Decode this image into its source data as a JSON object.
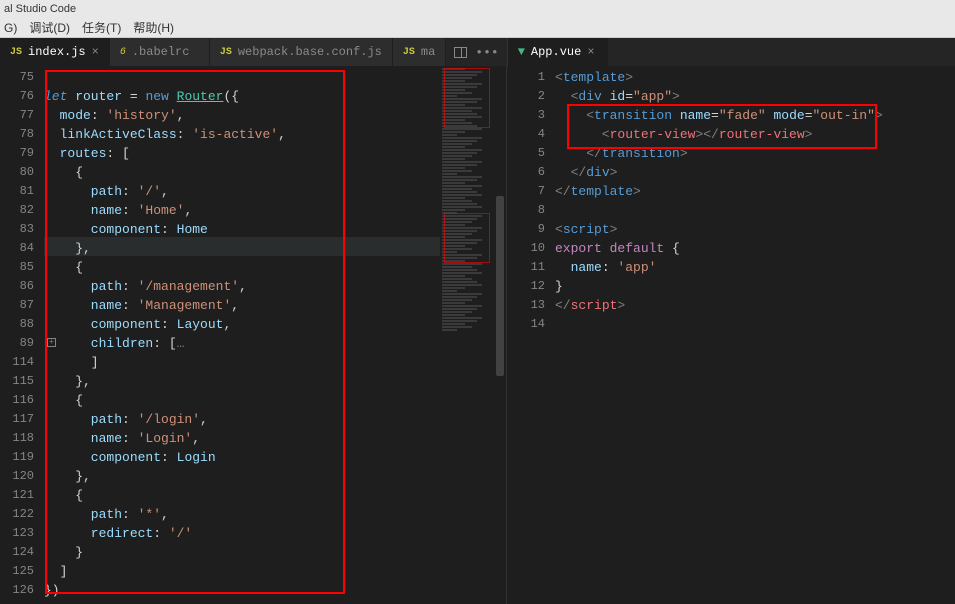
{
  "window": {
    "title": "al Studio Code"
  },
  "menu": {
    "goto": "G)",
    "debug": "调试(D)",
    "tasks": "任务(T)",
    "help": "帮助(H)"
  },
  "left_pane": {
    "tabs": [
      {
        "icon": "JS",
        "label": "index.js",
        "active": true,
        "closable": true
      },
      {
        "icon": "6",
        "label": ".babelrc",
        "active": false,
        "closable": false
      },
      {
        "icon": "JS",
        "label": "webpack.base.conf.js",
        "active": false,
        "closable": false
      },
      {
        "icon": "JS",
        "label": "ma",
        "active": false,
        "closable": false
      }
    ],
    "line_numbers": [
      "75",
      "76",
      "77",
      "78",
      "79",
      "80",
      "81",
      "82",
      "83",
      "84",
      "85",
      "86",
      "87",
      "88",
      "89",
      "114",
      "115",
      "116",
      "117",
      "118",
      "119",
      "120",
      "121",
      "122",
      "123",
      "124",
      "125",
      "126"
    ],
    "code": {
      "l76_let": "let",
      "l76_router": " router ",
      "l76_eq": "= ",
      "l76_new": "new",
      "l76_sp": " ",
      "l76_Router": "Router",
      "l76_paren": "({",
      "l77_mode": "  mode",
      "l77_c": ": ",
      "l77_v": "'history'",
      "l77_e": ",",
      "l78_k": "  linkActiveClass",
      "l78_c": ": ",
      "l78_v": "'is-active'",
      "l78_e": ",",
      "l79_k": "  routes",
      "l79_c": ": [",
      "l80": "    {",
      "l81_k": "      path",
      "l81_c": ": ",
      "l81_v": "'/'",
      "l81_e": ",",
      "l82_k": "      name",
      "l82_c": ": ",
      "l82_v": "'Home'",
      "l82_e": ",",
      "l83_k": "      component",
      "l83_c": ": ",
      "l83_v": "Home",
      "l84": "    },",
      "l85": "    {",
      "l86_k": "      path",
      "l86_c": ": ",
      "l86_v": "'/management'",
      "l86_e": ",",
      "l87_k": "      name",
      "l87_c": ": ",
      "l87_v": "'Management'",
      "l87_e": ",",
      "l88_k": "      component",
      "l88_c": ": ",
      "l88_v": "Layout",
      "l88_e": ",",
      "l89_k": "      children",
      "l89_c": ": [",
      "l89_d": "…",
      "l114": "      ]",
      "l115": "    },",
      "l116": "    {",
      "l117_k": "      path",
      "l117_c": ": ",
      "l117_v": "'/login'",
      "l117_e": ",",
      "l118_k": "      name",
      "l118_c": ": ",
      "l118_v": "'Login'",
      "l118_e": ",",
      "l119_k": "      component",
      "l119_c": ": ",
      "l119_v": "Login",
      "l120": "    },",
      "l121": "    {",
      "l122_k": "      path",
      "l122_c": ": ",
      "l122_v": "'*'",
      "l122_e": ",",
      "l123_k": "      redirect",
      "l123_c": ": ",
      "l123_v": "'/'",
      "l124": "    }",
      "l125": "  ]",
      "l126": "})"
    }
  },
  "right_pane": {
    "tab": {
      "icon": "V",
      "label": "App.vue",
      "active": true,
      "closable": true
    },
    "line_numbers": [
      "1",
      "2",
      "3",
      "4",
      "5",
      "6",
      "7",
      "8",
      "9",
      "10",
      "11",
      "12",
      "13",
      "14"
    ],
    "code": {
      "l1_o": "<",
      "l1_t": "template",
      "l1_c": ">",
      "l2_o": "  <",
      "l2_t": "div",
      "l2_a": " id",
      "l2_eq": "=",
      "l2_v": "\"app\"",
      "l2_c": ">",
      "l3_o": "    <",
      "l3_t": "transition",
      "l3_a1": " name",
      "l3_eq1": "=",
      "l3_v1": "\"fade\"",
      "l3_a2": " mode",
      "l3_eq2": "=",
      "l3_v2": "\"out-in\"",
      "l3_c": ">",
      "l4_o": "      <",
      "l4_t": "router-view",
      "l4_c1": "></",
      "l4_t2": "router-view",
      "l4_c2": ">",
      "l5_o": "    </",
      "l5_t": "transition",
      "l5_c": ">",
      "l6_o": "  </",
      "l6_t": "div",
      "l6_c": ">",
      "l7_o": "</",
      "l7_t": "template",
      "l7_c": ">",
      "l9_o": "<",
      "l9_t": "script",
      "l9_c": ">",
      "l10_e": "export",
      "l10_d": " default",
      "l10_b": " {",
      "l11_k": "  name",
      "l11_c": ": ",
      "l11_v": "'app'",
      "l12": "}",
      "l13_o": "</",
      "l13_t": "script",
      "l13_c": ">"
    }
  }
}
